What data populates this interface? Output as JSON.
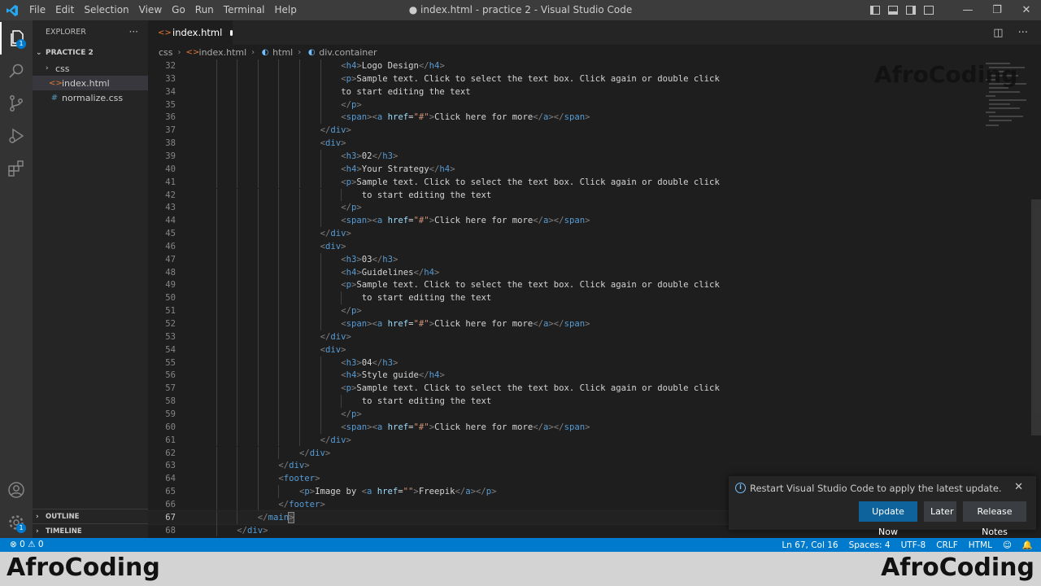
{
  "titlebar": {
    "menus": [
      "File",
      "Edit",
      "Selection",
      "View",
      "Go",
      "Run",
      "Terminal",
      "Help"
    ],
    "title": "● index.html - practice 2 - Visual Studio Code",
    "icons": [
      "toggle-sidebar-icon",
      "toggle-panel-icon",
      "toggle-secondary-sidebar-icon",
      "customize-layout-icon"
    ]
  },
  "activitybar": {
    "items": [
      "explorer",
      "search",
      "source-control",
      "run-debug",
      "extensions"
    ],
    "explorer_badge": "1",
    "accounts": "accounts",
    "manage_badge": "1"
  },
  "sidebar": {
    "header": "EXPLORER",
    "more": "···",
    "project": "PRACTICE 2",
    "tree": [
      {
        "label": "css",
        "type": "folder",
        "icon": "chevron-down-icon"
      },
      {
        "label": "index.html",
        "type": "html",
        "icon": "html-file-icon"
      },
      {
        "label": "normalize.css",
        "type": "css",
        "icon": "css-file-icon"
      }
    ],
    "outline": "OUTLINE",
    "timeline": "TIMELINE"
  },
  "tab": {
    "label": "index.html"
  },
  "breadcrumb": [
    "css",
    "index.html",
    "html",
    "div.container"
  ],
  "editor": {
    "current_line": 67,
    "lines": [
      {
        "n": 32,
        "i": 7,
        "t": [
          [
            "br",
            "<"
          ],
          [
            "tag",
            "h4"
          ],
          [
            "br",
            ">"
          ],
          [
            "txt",
            "Logo Design"
          ],
          [
            "br",
            "</"
          ],
          [
            "tag",
            "h4"
          ],
          [
            "br",
            ">"
          ]
        ]
      },
      {
        "n": 33,
        "i": 7,
        "t": [
          [
            "br",
            "<"
          ],
          [
            "tag",
            "p"
          ],
          [
            "br",
            ">"
          ],
          [
            "txt",
            "Sample text. Click to select the text box. Click again or double click"
          ]
        ]
      },
      {
        "n": 34,
        "i": 7,
        "t": [
          [
            "txt",
            "to start editing the text"
          ]
        ]
      },
      {
        "n": 35,
        "i": 7,
        "t": [
          [
            "br",
            "</"
          ],
          [
            "tag",
            "p"
          ],
          [
            "br",
            ">"
          ]
        ]
      },
      {
        "n": 36,
        "i": 7,
        "t": [
          [
            "br",
            "<"
          ],
          [
            "tag",
            "span"
          ],
          [
            "br",
            "><"
          ],
          [
            "tag",
            "a"
          ],
          [
            "txt",
            " "
          ],
          [
            "attr",
            "href"
          ],
          [
            "txt",
            "="
          ],
          [
            "str",
            "\"#\""
          ],
          [
            "br",
            ">"
          ],
          [
            "txt",
            "Click here for more"
          ],
          [
            "br",
            "</"
          ],
          [
            "tag",
            "a"
          ],
          [
            "br",
            "></"
          ],
          [
            "tag",
            "span"
          ],
          [
            "br",
            ">"
          ]
        ]
      },
      {
        "n": 37,
        "i": 6,
        "t": [
          [
            "br",
            "</"
          ],
          [
            "tag",
            "div"
          ],
          [
            "br",
            ">"
          ]
        ]
      },
      {
        "n": 38,
        "i": 6,
        "t": [
          [
            "br",
            "<"
          ],
          [
            "tag",
            "div"
          ],
          [
            "br",
            ">"
          ]
        ]
      },
      {
        "n": 39,
        "i": 7,
        "t": [
          [
            "br",
            "<"
          ],
          [
            "tag",
            "h3"
          ],
          [
            "br",
            ">"
          ],
          [
            "txt",
            "02"
          ],
          [
            "br",
            "</"
          ],
          [
            "tag",
            "h3"
          ],
          [
            "br",
            ">"
          ]
        ]
      },
      {
        "n": 40,
        "i": 7,
        "t": [
          [
            "br",
            "<"
          ],
          [
            "tag",
            "h4"
          ],
          [
            "br",
            ">"
          ],
          [
            "txt",
            "Your Strategy"
          ],
          [
            "br",
            "</"
          ],
          [
            "tag",
            "h4"
          ],
          [
            "br",
            ">"
          ]
        ]
      },
      {
        "n": 41,
        "i": 7,
        "t": [
          [
            "br",
            "<"
          ],
          [
            "tag",
            "p"
          ],
          [
            "br",
            ">"
          ],
          [
            "txt",
            "Sample text. Click to select the text box. Click again or double click"
          ]
        ]
      },
      {
        "n": 42,
        "i": 8,
        "t": [
          [
            "txt",
            "to start editing the text"
          ]
        ]
      },
      {
        "n": 43,
        "i": 7,
        "t": [
          [
            "br",
            "</"
          ],
          [
            "tag",
            "p"
          ],
          [
            "br",
            ">"
          ]
        ]
      },
      {
        "n": 44,
        "i": 7,
        "t": [
          [
            "br",
            "<"
          ],
          [
            "tag",
            "span"
          ],
          [
            "br",
            "><"
          ],
          [
            "tag",
            "a"
          ],
          [
            "txt",
            " "
          ],
          [
            "attr",
            "href"
          ],
          [
            "txt",
            "="
          ],
          [
            "str",
            "\"#\""
          ],
          [
            "br",
            ">"
          ],
          [
            "txt",
            "Click here for more"
          ],
          [
            "br",
            "</"
          ],
          [
            "tag",
            "a"
          ],
          [
            "br",
            "></"
          ],
          [
            "tag",
            "span"
          ],
          [
            "br",
            ">"
          ]
        ]
      },
      {
        "n": 45,
        "i": 6,
        "t": [
          [
            "br",
            "</"
          ],
          [
            "tag",
            "div"
          ],
          [
            "br",
            ">"
          ]
        ]
      },
      {
        "n": 46,
        "i": 6,
        "t": [
          [
            "br",
            "<"
          ],
          [
            "tag",
            "div"
          ],
          [
            "br",
            ">"
          ]
        ]
      },
      {
        "n": 47,
        "i": 7,
        "t": [
          [
            "br",
            "<"
          ],
          [
            "tag",
            "h3"
          ],
          [
            "br",
            ">"
          ],
          [
            "txt",
            "03"
          ],
          [
            "br",
            "</"
          ],
          [
            "tag",
            "h3"
          ],
          [
            "br",
            ">"
          ]
        ]
      },
      {
        "n": 48,
        "i": 7,
        "t": [
          [
            "br",
            "<"
          ],
          [
            "tag",
            "h4"
          ],
          [
            "br",
            ">"
          ],
          [
            "txt",
            "Guidelines"
          ],
          [
            "br",
            "</"
          ],
          [
            "tag",
            "h4"
          ],
          [
            "br",
            ">"
          ]
        ]
      },
      {
        "n": 49,
        "i": 7,
        "t": [
          [
            "br",
            "<"
          ],
          [
            "tag",
            "p"
          ],
          [
            "br",
            ">"
          ],
          [
            "txt",
            "Sample text. Click to select the text box. Click again or double click"
          ]
        ]
      },
      {
        "n": 50,
        "i": 8,
        "t": [
          [
            "txt",
            "to start editing the text"
          ]
        ]
      },
      {
        "n": 51,
        "i": 7,
        "t": [
          [
            "br",
            "</"
          ],
          [
            "tag",
            "p"
          ],
          [
            "br",
            ">"
          ]
        ]
      },
      {
        "n": 52,
        "i": 7,
        "t": [
          [
            "br",
            "<"
          ],
          [
            "tag",
            "span"
          ],
          [
            "br",
            "><"
          ],
          [
            "tag",
            "a"
          ],
          [
            "txt",
            " "
          ],
          [
            "attr",
            "href"
          ],
          [
            "txt",
            "="
          ],
          [
            "str",
            "\"#\""
          ],
          [
            "br",
            ">"
          ],
          [
            "txt",
            "Click here for more"
          ],
          [
            "br",
            "</"
          ],
          [
            "tag",
            "a"
          ],
          [
            "br",
            "></"
          ],
          [
            "tag",
            "span"
          ],
          [
            "br",
            ">"
          ]
        ]
      },
      {
        "n": 53,
        "i": 6,
        "t": [
          [
            "br",
            "</"
          ],
          [
            "tag",
            "div"
          ],
          [
            "br",
            ">"
          ]
        ]
      },
      {
        "n": 54,
        "i": 6,
        "t": [
          [
            "br",
            "<"
          ],
          [
            "tag",
            "div"
          ],
          [
            "br",
            ">"
          ]
        ]
      },
      {
        "n": 55,
        "i": 7,
        "t": [
          [
            "br",
            "<"
          ],
          [
            "tag",
            "h3"
          ],
          [
            "br",
            ">"
          ],
          [
            "txt",
            "04"
          ],
          [
            "br",
            "</"
          ],
          [
            "tag",
            "h3"
          ],
          [
            "br",
            ">"
          ]
        ]
      },
      {
        "n": 56,
        "i": 7,
        "t": [
          [
            "br",
            "<"
          ],
          [
            "tag",
            "h4"
          ],
          [
            "br",
            ">"
          ],
          [
            "txt",
            "Style guide"
          ],
          [
            "br",
            "</"
          ],
          [
            "tag",
            "h4"
          ],
          [
            "br",
            ">"
          ]
        ]
      },
      {
        "n": 57,
        "i": 7,
        "t": [
          [
            "br",
            "<"
          ],
          [
            "tag",
            "p"
          ],
          [
            "br",
            ">"
          ],
          [
            "txt",
            "Sample text. Click to select the text box. Click again or double click"
          ]
        ]
      },
      {
        "n": 58,
        "i": 8,
        "t": [
          [
            "txt",
            "to start editing the text"
          ]
        ]
      },
      {
        "n": 59,
        "i": 7,
        "t": [
          [
            "br",
            "</"
          ],
          [
            "tag",
            "p"
          ],
          [
            "br",
            ">"
          ]
        ]
      },
      {
        "n": 60,
        "i": 7,
        "t": [
          [
            "br",
            "<"
          ],
          [
            "tag",
            "span"
          ],
          [
            "br",
            "><"
          ],
          [
            "tag",
            "a"
          ],
          [
            "txt",
            " "
          ],
          [
            "attr",
            "href"
          ],
          [
            "txt",
            "="
          ],
          [
            "str",
            "\"#\""
          ],
          [
            "br",
            ">"
          ],
          [
            "txt",
            "Click here for more"
          ],
          [
            "br",
            "</"
          ],
          [
            "tag",
            "a"
          ],
          [
            "br",
            "></"
          ],
          [
            "tag",
            "span"
          ],
          [
            "br",
            ">"
          ]
        ]
      },
      {
        "n": 61,
        "i": 6,
        "t": [
          [
            "br",
            "</"
          ],
          [
            "tag",
            "div"
          ],
          [
            "br",
            ">"
          ]
        ]
      },
      {
        "n": 62,
        "i": 5,
        "t": [
          [
            "br",
            "</"
          ],
          [
            "tag",
            "div"
          ],
          [
            "br",
            ">"
          ]
        ]
      },
      {
        "n": 63,
        "i": 4,
        "t": [
          [
            "br",
            "</"
          ],
          [
            "tag",
            "div"
          ],
          [
            "br",
            ">"
          ]
        ]
      },
      {
        "n": 64,
        "i": 4,
        "t": [
          [
            "br",
            "<"
          ],
          [
            "tag",
            "footer"
          ],
          [
            "br",
            ">"
          ]
        ]
      },
      {
        "n": 65,
        "i": 5,
        "t": [
          [
            "br",
            "<"
          ],
          [
            "tag",
            "p"
          ],
          [
            "br",
            ">"
          ],
          [
            "txt",
            "Image by "
          ],
          [
            "br",
            "<"
          ],
          [
            "tag",
            "a"
          ],
          [
            "txt",
            " "
          ],
          [
            "attr",
            "href"
          ],
          [
            "txt",
            "="
          ],
          [
            "str",
            "\"\""
          ],
          [
            "br",
            ">"
          ],
          [
            "txt",
            "Freepik"
          ],
          [
            "br",
            "</"
          ],
          [
            "tag",
            "a"
          ],
          [
            "br",
            "></"
          ],
          [
            "tag",
            "p"
          ],
          [
            "br",
            ">"
          ]
        ]
      },
      {
        "n": 66,
        "i": 4,
        "t": [
          [
            "br",
            "</"
          ],
          [
            "tag",
            "footer"
          ],
          [
            "br",
            ">"
          ]
        ]
      },
      {
        "n": 67,
        "i": 3,
        "t": [
          [
            "br",
            "</"
          ],
          [
            "tag",
            "main"
          ],
          [
            "hl",
            ">"
          ]
        ]
      },
      {
        "n": 68,
        "i": 2,
        "t": [
          [
            "br",
            "</"
          ],
          [
            "tag",
            "div"
          ],
          [
            "br",
            ">"
          ]
        ]
      }
    ]
  },
  "watermark_top": "AfroCoding",
  "notification": {
    "message": "Restart Visual Studio Code to apply the latest update.",
    "buttons": [
      "Update Now",
      "Later",
      "Release Notes"
    ],
    "close": "✕"
  },
  "statusbar": {
    "problems": "⊗ 0 ⚠ 0",
    "position": "Ln 67, Col 16",
    "spaces": "Spaces: 4",
    "encoding": "UTF-8",
    "eol": "CRLF",
    "language": "HTML"
  },
  "banner": {
    "left": "AfroCoding",
    "right": "AfroCoding"
  },
  "colors": {
    "accent": "#007acc",
    "tag": "#569cd6",
    "attr": "#9cdcfe",
    "string": "#ce9178",
    "bracket": "#808080",
    "text": "#d4d4d4"
  }
}
